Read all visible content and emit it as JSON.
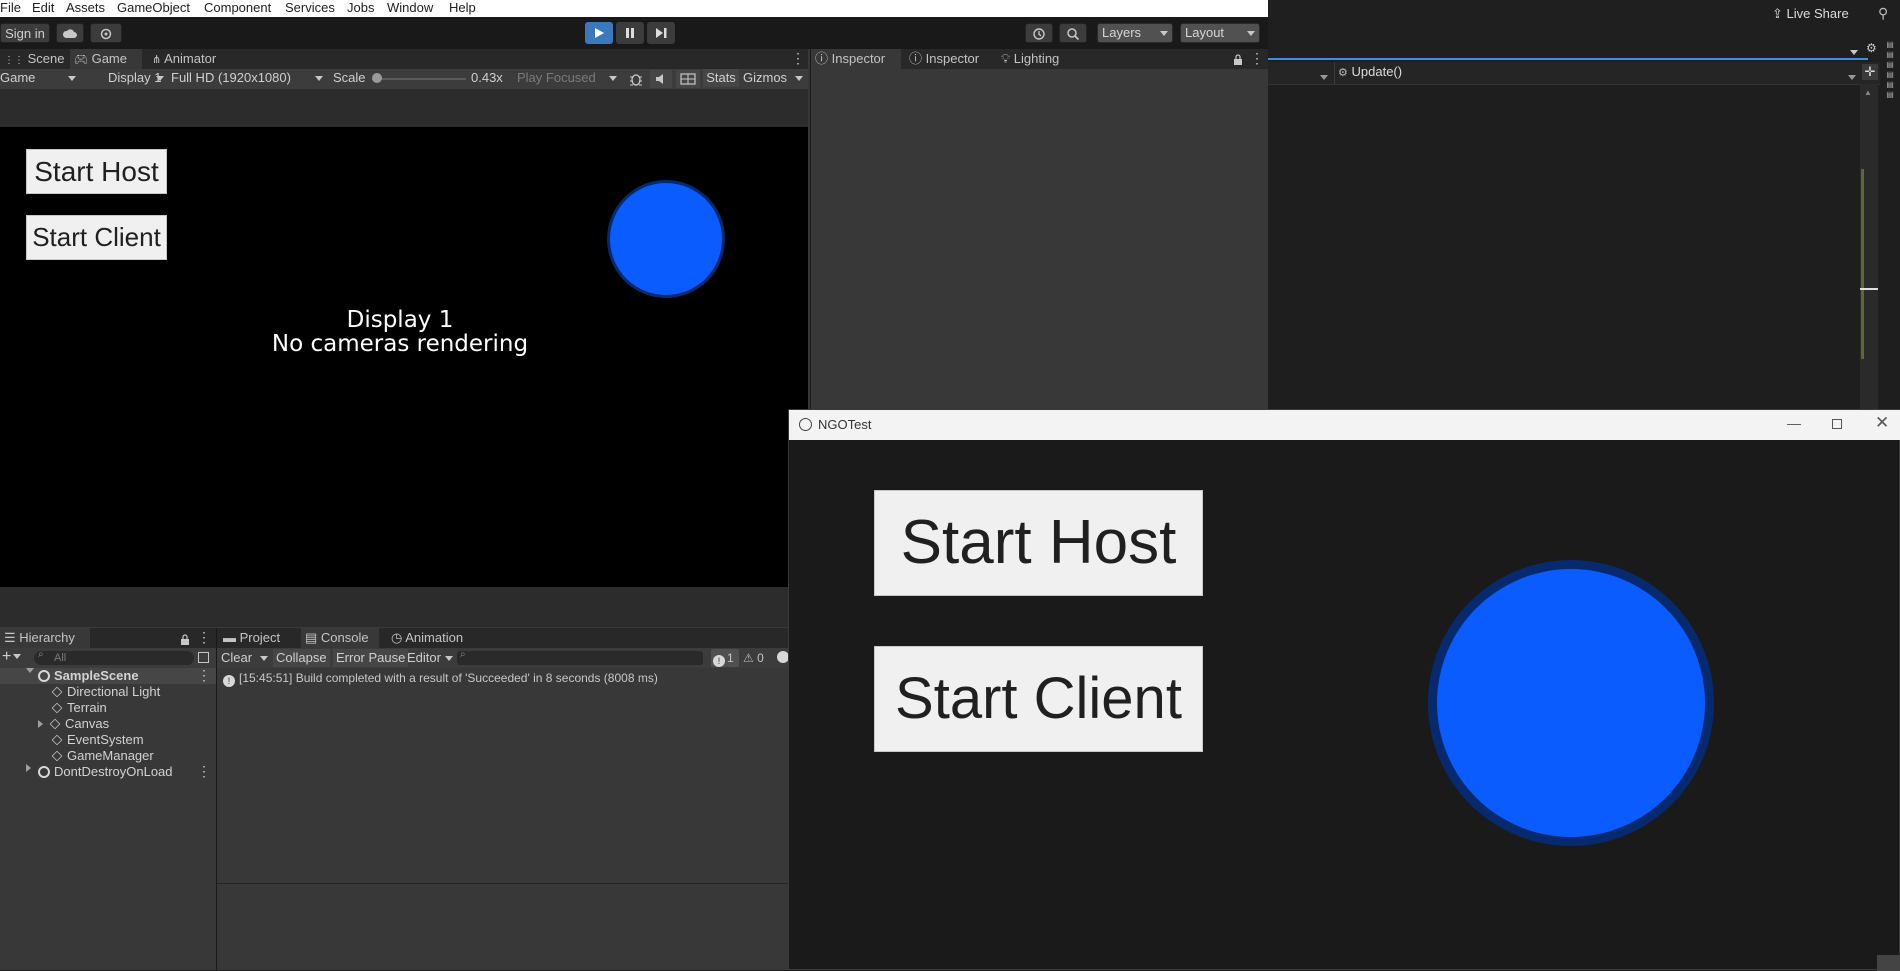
{
  "menu": [
    "File",
    "Edit",
    "Assets",
    "GameObject",
    "Component",
    "Services",
    "Jobs",
    "Window",
    "Help"
  ],
  "toolbar": {
    "sign_in": "Sign in",
    "layers": "Layers",
    "layout": "Layout"
  },
  "game_tabs": [
    "Scene",
    "Game",
    "Animator"
  ],
  "game_controls": {
    "view": "Game",
    "display": "Display 1",
    "resolution": "Full HD (1920x1080)",
    "scale_label": "Scale",
    "scale_value": "0.43x",
    "scale_level": 0.0,
    "play_focused": "Play Focused",
    "stats": "Stats",
    "gizmos": "Gizmos"
  },
  "game_view": {
    "start_host": "Start Host",
    "start_client": "Start Client",
    "message_line1": "Display 1",
    "message_line2": "No cameras rendering"
  },
  "inspector_tabs": [
    "Inspector",
    "Inspector",
    "Lighting"
  ],
  "hierarchy": {
    "title": "Hierarchy",
    "search_placeholder": "All",
    "items": [
      "SampleScene",
      "Directional Light",
      "Terrain",
      "Canvas",
      "EventSystem",
      "GameManager",
      "DontDestroyOnLoad"
    ]
  },
  "bottom_tabs": [
    "Project",
    "Console",
    "Animation"
  ],
  "console": {
    "clear": "Clear",
    "collapse": "Collapse",
    "error_pause": "Error Pause",
    "editor": "Editor",
    "info_count": "1",
    "warn_count": "0",
    "log_entry": "[15:45:51] Build completed with a result of 'Succeeded' in 8 seconds (8008 ms)"
  },
  "vs": {
    "live_share": "Live Share",
    "method": "Update()"
  },
  "ngotest": {
    "title": "NGOTest",
    "start_host": "Start Host",
    "start_client": "Start Client"
  },
  "colors": {
    "circle_blue": "#0a5cff",
    "accent_blue": "#3d8ee6"
  }
}
